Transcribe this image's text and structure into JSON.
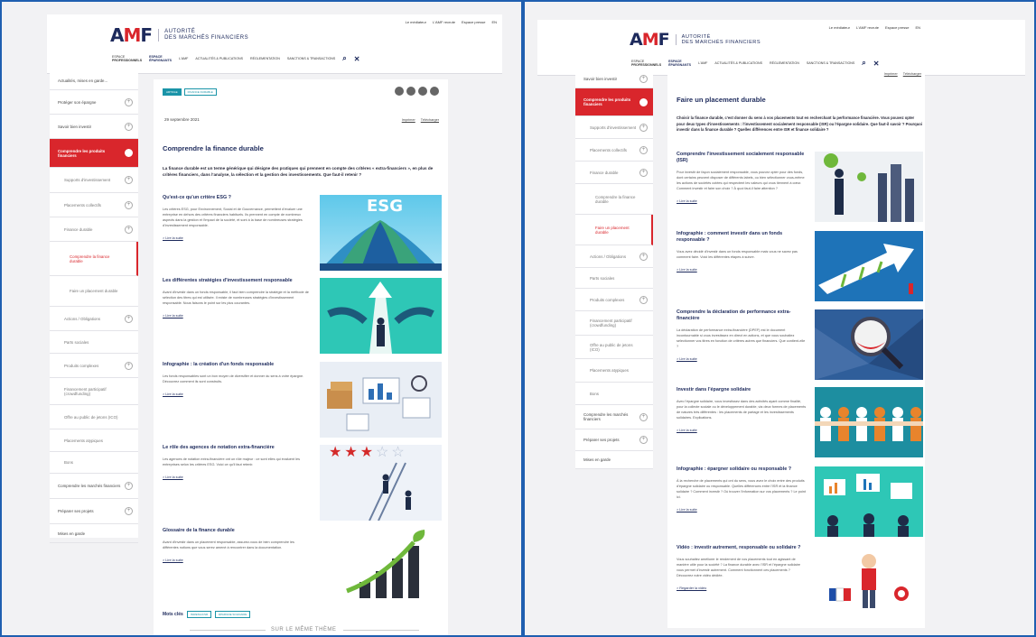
{
  "header": {
    "logo_mark": "AMF",
    "logo_line1": "AUTORITÉ",
    "logo_line2": "DES MARCHÉS FINANCIERS",
    "toplinks": [
      "Le médiateur",
      "L'AMF recrute",
      "Espace presse",
      "EN"
    ],
    "nav_pro": [
      "ESPACE",
      "PROFESSIONNELS"
    ],
    "nav_epargnants": [
      "ESPACE",
      "ÉPARGNANTS"
    ],
    "nav": [
      "L'AMF",
      "ACTUALITÉS & PUBLICATIONS",
      "RÉGLEMENTATION",
      "SANCTIONS & TRANSACTIONS"
    ]
  },
  "page1": {
    "sidebar": [
      {
        "label": "Actualités, mises en garde...",
        "kind": "top"
      },
      {
        "label": "Protéger son épargne",
        "kind": "top",
        "plus": true
      },
      {
        "label": "Savoir bien investir",
        "kind": "top",
        "plus": true
      },
      {
        "label": "Comprendre les produits financiers",
        "kind": "active",
        "plus": true
      },
      {
        "label": "Supports d'investissement",
        "kind": "sub",
        "plus": true
      },
      {
        "label": "Placements collectifs",
        "kind": "sub",
        "plus": true
      },
      {
        "label": "Finance durable",
        "kind": "sub",
        "plus": true
      },
      {
        "label": "Comprendre la finance durable",
        "kind": "sub2"
      },
      {
        "label": "Faire un placement durable",
        "kind": "sub3"
      },
      {
        "label": "Actions / Obligations",
        "kind": "sub",
        "plus": true
      },
      {
        "label": "Parts sociales",
        "kind": "sub"
      },
      {
        "label": "Produits complexes",
        "kind": "sub",
        "plus": true
      },
      {
        "label": "Financement participatif (crowdfunding)",
        "kind": "sub"
      },
      {
        "label": "Offre au public de jetons (ICO)",
        "kind": "sub"
      },
      {
        "label": "Placements atypiques",
        "kind": "sub"
      },
      {
        "label": "Bons",
        "kind": "sub"
      },
      {
        "label": "Comprendre les marchés financiers",
        "kind": "top",
        "plus": true
      },
      {
        "label": "Préparer ses projets",
        "kind": "top",
        "plus": true
      },
      {
        "label": "Mises en garde",
        "kind": "top"
      }
    ],
    "tags": [
      "ARTICLE",
      "FINANCE DURABLE"
    ],
    "date": "29 septembre 2021",
    "print": "Imprimer",
    "download": "Télécharger",
    "title": "Comprendre la finance durable",
    "intro": "La finance durable est un terme générique qui désigne des pratiques qui prennent en compte des critères « extra-financiers », en plus de critères financiers, dans l'analyse, la sélection et la gestion des investissements. Que faut-il retenir ?",
    "articles": [
      {
        "title": "Qu'est-ce qu'un critère ESG ?",
        "desc": "Les critères ESG, pour Environnement, Social et de Gouvernance, permettent d'évaluer une entreprise en dehors des critères financiers habituels. Ils prennent en compte de nombreux aspects dans la gestion et l'impact de la société, et sont à la base de nombreuses stratégies d'investissement responsable.",
        "more": "> Lire la suite"
      },
      {
        "title": "Les différentes stratégies d'investissement responsable",
        "desc": "Avant d'investir dans un fonds responsable, il faut bien comprendre la stratégie et la méthode de sélection des titres qui est utilisée. Il existe de nombreuses stratégies d'investissement responsable. Nous faisons le point sur les plus courantes.",
        "more": "> Lire la suite"
      },
      {
        "title": "Infographie : la création d'un fonds responsable",
        "desc": "Les fonds responsables sont un bon moyen de diversifier et donner du sens à votre épargne. Découvrez comment ils sont construits.",
        "more": "> Lire la suite"
      },
      {
        "title": "Le rôle des agences de notation extra-financière",
        "desc": "Les agences de notation extra-financière ont un rôle majeur : ce sont elles qui évaluent les entreprises selon les critères ESG. Voici ce qu'il faut retenir.",
        "more": "> Lire la suite"
      },
      {
        "title": "Glossaire de la finance durable",
        "desc": "Avant d'investir dans un placement responsable, assurez-vous de bien comprendre les différentes notions que vous serez amené à rencontrer dans la documentation.",
        "more": "> Lire la suite"
      }
    ],
    "esg_label": "ESG",
    "keywords_label": "Mots clés",
    "keywords": [
      "ISR/ESG/CSR",
      "ÉPARGNE SOLIDAIRE"
    ],
    "same_theme": "SUR LE MÊME THÈME"
  },
  "page2": {
    "sidebar": [
      {
        "label": "Savoir bien investir",
        "kind": "top",
        "plus": true
      },
      {
        "label": "Comprendre les produits financiers",
        "kind": "active",
        "plus": true
      },
      {
        "label": "Supports d'investissement",
        "kind": "sub",
        "plus": true
      },
      {
        "label": "Placements collectifs",
        "kind": "sub",
        "plus": true
      },
      {
        "label": "Finance durable",
        "kind": "sub",
        "plus": true
      },
      {
        "label": "Comprendre la finance durable",
        "kind": "sub3"
      },
      {
        "label": "Faire un placement durable",
        "kind": "sub2"
      },
      {
        "label": "Actions / Obligations",
        "kind": "sub",
        "plus": true
      },
      {
        "label": "Parts sociales",
        "kind": "sub"
      },
      {
        "label": "Produits complexes",
        "kind": "sub",
        "plus": true
      },
      {
        "label": "Financement participatif (crowdfunding)",
        "kind": "sub"
      },
      {
        "label": "Offre au public de jetons (ICO)",
        "kind": "sub"
      },
      {
        "label": "Placements atypiques",
        "kind": "sub"
      },
      {
        "label": "Bons",
        "kind": "sub"
      },
      {
        "label": "Comprendre les marchés financiers",
        "kind": "top",
        "plus": true
      },
      {
        "label": "Préparer ses projets",
        "kind": "top",
        "plus": true
      },
      {
        "label": "Mises en garde",
        "kind": "top"
      }
    ],
    "print": "Imprimer",
    "download": "Télécharger",
    "title": "Faire un placement durable",
    "intro": "Choisir la finance durable, c'est donner du sens à vos placements tout en recherchant la performance financière. Vous pouvez opter pour deux types d'investissements : l'investissement socialement responsable (ISR) ou l'épargne solidaire. Que faut-il savoir ? Pourquoi investir dans la finance durable ? Quelles différences entre ISR et finance solidaire ?",
    "articles": [
      {
        "title": "Comprendre l'investissement socialement responsable (ISR)",
        "desc": "Pour investir de façon socialement responsable, vous pouvez opter pour des fonds, dont certains peuvent disposer de différents labels, ou bien sélectionner vous-même les actions de sociétés cotées qui respectent les valeurs qui vous tiennent à cœur. Comment investir et faire son choix ? À quoi faut-il faire attention ?",
        "more": "> Lire la suite"
      },
      {
        "title": "Infographie : comment investir dans un fonds responsable ?",
        "desc": "Vous avez décidé d'investir dans un fonds responsable mais vous ne savez pas comment faire. Voici les différentes étapes à suivre.",
        "more": "> Lire la suite"
      },
      {
        "title": "Comprendre la déclaration de performance extra-financière",
        "desc": "La déclaration de performance extra-financière (DPEF) est le document incontournable si vous investissez en direct en actions, et que vous souhaitez sélectionner vos titres en fonction de critères autres que financiers. Que contient-elle ?",
        "more": "> Lire la suite"
      },
      {
        "title": "Investir dans l'épargne solidaire",
        "desc": "Avec l'épargne solidaire, vous investissez dans des activités ayant comme finalité, pour la collecte sociale ou le développement durable, via deux formes de placements de natures très différentes : les placements de partage et les investissements solidaires. Explications.",
        "more": "> Lire la suite"
      },
      {
        "title": "Infographie : épargner solidaire ou responsable ?",
        "desc": "À la recherche de placements qui ont du sens, vous avez le choix entre des produits d'épargne solidaire ou responsable. Quelles différences entre l'ISR et la finance solidaire ? Comment investir ? Où trouver l'information sur vos placements ? Le point ici.",
        "more": "> Lire la suite"
      },
      {
        "title": "Vidéo : investir autrement, responsable ou solidaire ?",
        "desc": "Vous souhaitez améliorer le rendement de vos placements tout en agissant de manière utile pour la société ? La finance durable avec l'ISR et l'épargne solidaire vous permet d'investir autrement. Comment fonctionnent ces placements ? Découvrez notre vidéo dédiée.",
        "more": "> Regarder la vidéo"
      }
    ]
  },
  "colors": {
    "brand": "#1d2a5c",
    "accent": "#d9262c",
    "teal": "#1a94a8"
  }
}
